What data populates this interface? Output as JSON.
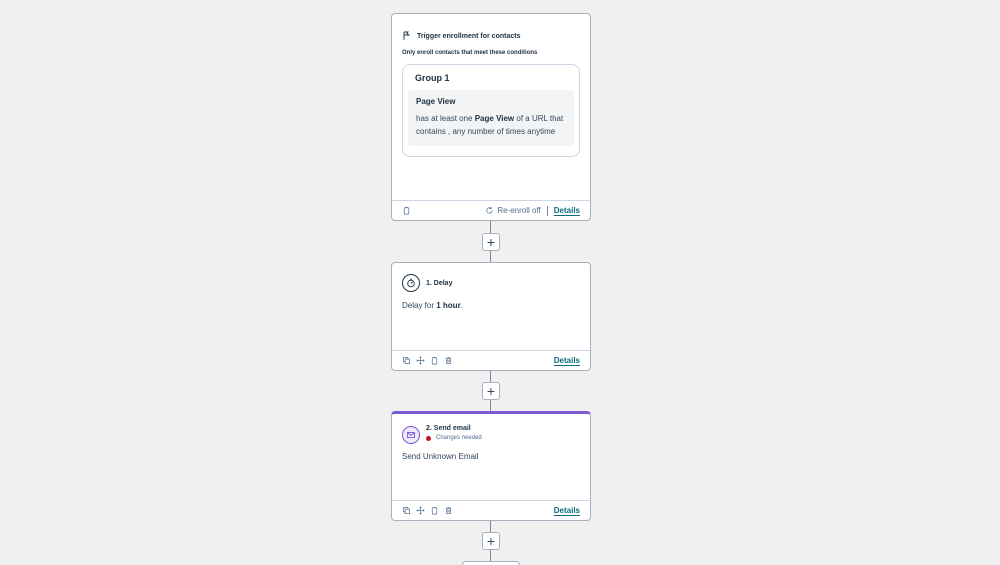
{
  "trigger": {
    "title": "Trigger enrollment for contacts",
    "subtitle": "Only enroll contacts that meet these conditions",
    "group_title": "Group 1",
    "filter_title": "Page View",
    "filter_desc_pre": "has at least one ",
    "filter_desc_bold": "Page View",
    "filter_desc_post": " of a URL that contains , any number of times anytime",
    "reenroll_label": "Re-enroll off",
    "details_label": "Details"
  },
  "delay": {
    "title": "1. Delay",
    "body_pre": "Delay for ",
    "body_bold": "1 hour",
    "body_post": ".",
    "details_label": "Details"
  },
  "email": {
    "title": "2. Send email",
    "status": "Changes needed",
    "body": "Send Unknown Email",
    "details_label": "Details",
    "accent_color": "#7c59d4",
    "status_color": "#c0122f"
  },
  "add_button_label": "+",
  "icons": [
    "flag-icon",
    "trash-icon",
    "refresh-icon",
    "timer-icon",
    "copy-icon",
    "move-icon",
    "clipboard-icon",
    "delete-icon",
    "mail-icon"
  ]
}
